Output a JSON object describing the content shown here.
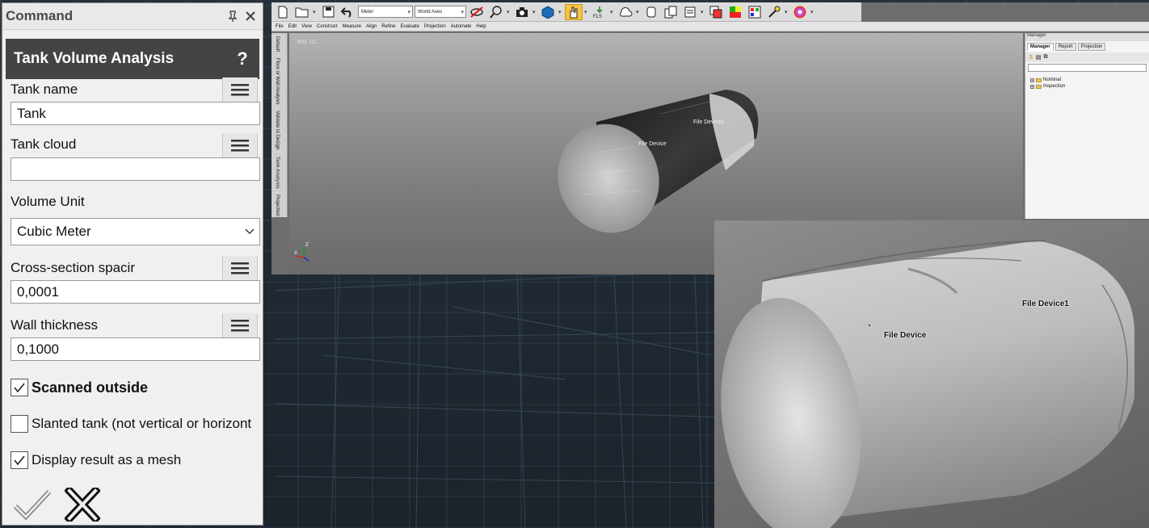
{
  "command_panel": {
    "title": "Command",
    "analysis_title": "Tank Volume Analysis",
    "help_label": "?",
    "fields": {
      "tank_name": {
        "label": "Tank name",
        "value": "Tank"
      },
      "tank_cloud": {
        "label": "Tank cloud",
        "value": ""
      },
      "volume_unit": {
        "label": "Volume Unit",
        "value": "Cubic Meter"
      },
      "cross_section": {
        "label": "Cross-section spacir",
        "value": "0,0001"
      },
      "wall_thickness": {
        "label": "Wall thickness",
        "value": "0,1000"
      }
    },
    "checkboxes": {
      "scanned_outside": {
        "label": "Scanned outside",
        "checked": true
      },
      "slanted_tank": {
        "label": "Slanted tank (not vertical or horizont",
        "checked": false
      },
      "display_mesh": {
        "label": "Display result as a mesh",
        "checked": true
      }
    }
  },
  "toolbar": {
    "unit_select": "Meter",
    "axes_select": "World Axes"
  },
  "menubar": [
    "File",
    "Edit",
    "View",
    "Construct",
    "Measure",
    "Align",
    "Refine",
    "Evaluate",
    "Projection",
    "Automate",
    "Help"
  ],
  "side_tabs": [
    "Default",
    "Floor or Wall Analysis",
    "Validate to Design",
    "Tank Analysis",
    "Projection"
  ],
  "viewport": {
    "corner_text": "RO IC",
    "label_device": "File Device",
    "label_device1": "File Device1"
  },
  "manager": {
    "title": "Manager",
    "tabs": [
      "Manager",
      "Report",
      "Projection"
    ],
    "tree": [
      "Nominal",
      "Inspection"
    ]
  },
  "inset": {
    "label_device": "File Device",
    "label_device1": "File Device1"
  }
}
